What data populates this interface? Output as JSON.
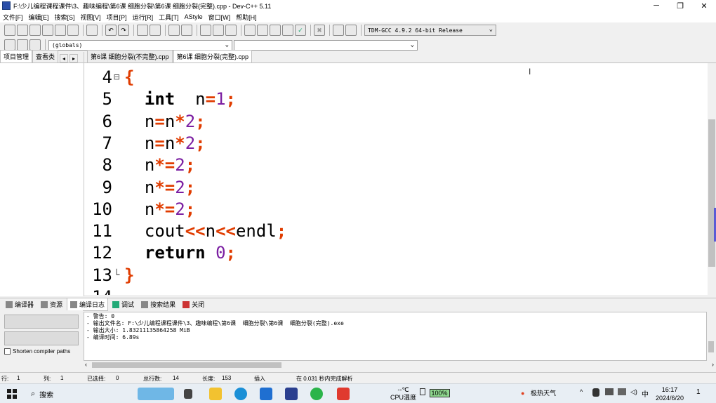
{
  "window": {
    "title": "F:\\少儿编程课程课件\\3、趣味编程\\第6课  细胞分裂\\第6课  细胞分裂(完整).cpp - Dev-C++ 5.11",
    "controls": [
      "─",
      "❐",
      "✕"
    ]
  },
  "menu": [
    "文件[F]",
    "编辑[E]",
    "搜索[S]",
    "视图[V]",
    "项目[P]",
    "运行[R]",
    "工具[T]",
    "AStyle",
    "窗口[W]",
    "帮助[H]"
  ],
  "toolbar": {
    "compiler": "TDM-GCC 4.9.2 64-bit Release",
    "scope": "(globals)",
    "member": ""
  },
  "left_panel": {
    "tabs": [
      "项目管理",
      "查看类"
    ]
  },
  "file_tabs": [
    "第6课  细胞分裂(不完整).cpp",
    "第6课  细胞分裂(完整).cpp"
  ],
  "editor": {
    "lines": [
      {
        "no": "4",
        "fold": "⊟",
        "tokens": [
          {
            "t": "{",
            "c": "op"
          }
        ]
      },
      {
        "no": "5",
        "fold": "",
        "tokens": [
          {
            "t": "  ",
            "c": ""
          },
          {
            "t": "int",
            "c": "kw"
          },
          {
            "t": "  n",
            "c": ""
          },
          {
            "t": "=",
            "c": "op"
          },
          {
            "t": "1",
            "c": "num"
          },
          {
            "t": ";",
            "c": "op"
          }
        ]
      },
      {
        "no": "6",
        "fold": "",
        "tokens": [
          {
            "t": "  n",
            "c": ""
          },
          {
            "t": "=",
            "c": "op"
          },
          {
            "t": "n",
            "c": ""
          },
          {
            "t": "*",
            "c": "op"
          },
          {
            "t": "2",
            "c": "num"
          },
          {
            "t": ";",
            "c": "op"
          }
        ]
      },
      {
        "no": "7",
        "fold": "",
        "tokens": [
          {
            "t": "  n",
            "c": ""
          },
          {
            "t": "=",
            "c": "op"
          },
          {
            "t": "n",
            "c": ""
          },
          {
            "t": "*",
            "c": "op"
          },
          {
            "t": "2",
            "c": "num"
          },
          {
            "t": ";",
            "c": "op"
          }
        ]
      },
      {
        "no": "8",
        "fold": "",
        "tokens": [
          {
            "t": "  n",
            "c": ""
          },
          {
            "t": "*=",
            "c": "op"
          },
          {
            "t": "2",
            "c": "num"
          },
          {
            "t": ";",
            "c": "op"
          }
        ]
      },
      {
        "no": "9",
        "fold": "",
        "tokens": [
          {
            "t": "  n",
            "c": ""
          },
          {
            "t": "*=",
            "c": "op"
          },
          {
            "t": "2",
            "c": "num"
          },
          {
            "t": ";",
            "c": "op"
          }
        ]
      },
      {
        "no": "10",
        "fold": "",
        "tokens": [
          {
            "t": "  n",
            "c": ""
          },
          {
            "t": "*=",
            "c": "op"
          },
          {
            "t": "2",
            "c": "num"
          },
          {
            "t": ";",
            "c": "op"
          }
        ]
      },
      {
        "no": "11",
        "fold": "",
        "tokens": [
          {
            "t": "  cout",
            "c": ""
          },
          {
            "t": "<<",
            "c": "op"
          },
          {
            "t": "n",
            "c": ""
          },
          {
            "t": "<<",
            "c": "op"
          },
          {
            "t": "endl",
            "c": ""
          },
          {
            "t": ";",
            "c": "op"
          }
        ]
      },
      {
        "no": "12",
        "fold": "",
        "tokens": [
          {
            "t": "  ",
            "c": ""
          },
          {
            "t": "return",
            "c": "kw"
          },
          {
            "t": " ",
            "c": ""
          },
          {
            "t": "0",
            "c": "num"
          },
          {
            "t": ";",
            "c": "op"
          }
        ]
      },
      {
        "no": "13",
        "fold": "└",
        "tokens": [
          {
            "t": "}",
            "c": "op"
          }
        ]
      },
      {
        "no": "14",
        "fold": "",
        "tokens": []
      }
    ]
  },
  "bottom_tabs": [
    "编译器",
    "资源",
    "编译日志",
    "调试",
    "搜索结果",
    "关闭"
  ],
  "bottom_left": {
    "shorten_label": "Shorten compiler paths"
  },
  "log_lines": [
    "- 警告: 0",
    "- 输出文件名: F:\\少儿编程课程课件\\3、趣味编程\\第6课  细胞分裂\\第6课  细胞分裂(完整).exe",
    "- 输出大小: 1.83211135864258 MiB",
    "- 编译时间: 6.89s"
  ],
  "status": {
    "row_label": "行:",
    "row": "1",
    "col_label": "列:",
    "col": "1",
    "sel_label": "已选择:",
    "sel": "0",
    "total_label": "总行数:",
    "total": "14",
    "len_label": "长度:",
    "len": "153",
    "mode": "插入",
    "parse": "在 0.031 秒内完成解析"
  },
  "taskbar": {
    "search": "搜索",
    "temp": "--℃",
    "temp_label": "CPU温度",
    "battery": "100%",
    "weather": "极热天气",
    "ime": "中",
    "time": "16:17",
    "date": "2024/6/20",
    "notif": "1"
  }
}
